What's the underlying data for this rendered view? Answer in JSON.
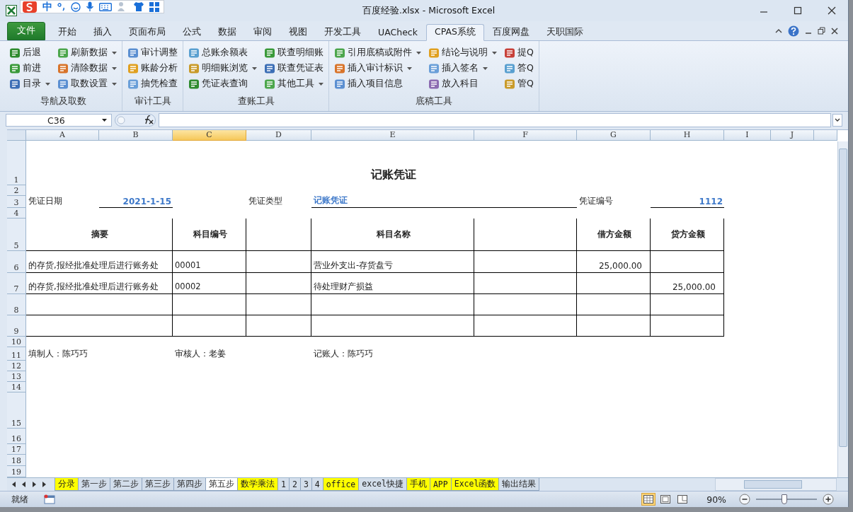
{
  "ime": {
    "label": "中"
  },
  "window": {
    "title": "百度经验.xlsx  -  Microsoft Excel"
  },
  "ribbon_tabs": [
    {
      "label": "文件",
      "kind": "file",
      "selected": false
    },
    {
      "label": "开始",
      "kind": "tab",
      "selected": false
    },
    {
      "label": "插入",
      "kind": "tab",
      "selected": false
    },
    {
      "label": "页面布局",
      "kind": "tab",
      "selected": false
    },
    {
      "label": "公式",
      "kind": "tab",
      "selected": false
    },
    {
      "label": "数据",
      "kind": "tab",
      "selected": false
    },
    {
      "label": "审阅",
      "kind": "tab",
      "selected": false
    },
    {
      "label": "视图",
      "kind": "tab",
      "selected": false
    },
    {
      "label": "开发工具",
      "kind": "tab",
      "selected": false
    },
    {
      "label": "UACheck",
      "kind": "tab",
      "selected": false
    },
    {
      "label": "CPAS系统",
      "kind": "tab",
      "selected": true
    },
    {
      "label": "百度网盘",
      "kind": "tab",
      "selected": false
    },
    {
      "label": "天职国际",
      "kind": "tab",
      "selected": false
    }
  ],
  "ribbon_groups": [
    {
      "label": "导航及取数",
      "columns": [
        [
          {
            "label": "后退",
            "dropdown": false
          },
          {
            "label": "前进",
            "dropdown": false
          },
          {
            "label": "目录",
            "dropdown": true
          }
        ],
        [
          {
            "label": "刷新数据",
            "dropdown": true
          },
          {
            "label": "清除数据",
            "dropdown": true
          },
          {
            "label": "取数设置",
            "dropdown": true
          }
        ]
      ]
    },
    {
      "label": "审计工具",
      "columns": [
        [
          {
            "label": "审计调整",
            "dropdown": false
          },
          {
            "label": "账龄分析",
            "dropdown": false
          },
          {
            "label": "抽凭检查",
            "dropdown": false
          }
        ]
      ]
    },
    {
      "label": "查账工具",
      "columns": [
        [
          {
            "label": "总账余额表",
            "dropdown": false
          },
          {
            "label": "明细账浏览",
            "dropdown": true
          },
          {
            "label": "凭证表查询",
            "dropdown": false
          }
        ],
        [
          {
            "label": "联查明细账",
            "dropdown": false
          },
          {
            "label": "联查凭证表",
            "dropdown": false
          },
          {
            "label": "其他工具",
            "dropdown": true
          }
        ]
      ]
    },
    {
      "label": "底稿工具",
      "columns": [
        [
          {
            "label": "引用底稿或附件",
            "dropdown": true
          },
          {
            "label": "插入审计标识",
            "dropdown": true
          },
          {
            "label": "插入项目信息",
            "dropdown": false
          }
        ],
        [
          {
            "label": "结论与说明",
            "dropdown": true
          },
          {
            "label": "插入签名",
            "dropdown": true
          },
          {
            "label": "放入科目",
            "dropdown": false
          }
        ],
        [
          {
            "label": "提Q",
            "dropdown": false
          },
          {
            "label": "答Q",
            "dropdown": false
          },
          {
            "label": "管Q",
            "dropdown": false
          }
        ]
      ]
    }
  ],
  "name_box": {
    "value": "C36"
  },
  "sheet": {
    "columns": [
      {
        "label": "A",
        "selected": false
      },
      {
        "label": "B",
        "selected": false
      },
      {
        "label": "C",
        "selected": true
      },
      {
        "label": "D",
        "selected": false
      },
      {
        "label": "E",
        "selected": false
      },
      {
        "label": "F",
        "selected": false
      },
      {
        "label": "G",
        "selected": false
      },
      {
        "label": "H",
        "selected": false
      },
      {
        "label": "I",
        "selected": false
      },
      {
        "label": "J",
        "selected": false
      }
    ],
    "rows": [
      "1",
      "2",
      "3",
      "4",
      "5",
      "6",
      "7",
      "8",
      "9",
      "10",
      "11",
      "12",
      "13",
      "14",
      "15",
      "16",
      "17",
      "18",
      "19"
    ],
    "cells": [
      {
        "kind": "title",
        "text": "记账凭证"
      },
      {
        "kind": "label",
        "text": "凭证日期"
      },
      {
        "kind": "figure",
        "text": "2021-1-15"
      },
      {
        "kind": "label",
        "text": "凭证类型"
      },
      {
        "kind": "field",
        "text": "记账凭证"
      },
      {
        "kind": "label",
        "text": "凭证编号"
      },
      {
        "kind": "figure",
        "text": "1112"
      },
      {
        "kind": "header",
        "text": "摘要"
      },
      {
        "kind": "header",
        "text": "科目编号"
      },
      {
        "kind": "header",
        "text": "科目名称"
      },
      {
        "kind": "header",
        "text": "借方金额"
      },
      {
        "kind": "header",
        "text": "贷方金额"
      },
      {
        "kind": "text",
        "text": "的存货,报经批准处理后进行账务处"
      },
      {
        "kind": "text",
        "text": "00001"
      },
      {
        "kind": "text",
        "text": "营业外支出-存货盘亏"
      },
      {
        "kind": "amount",
        "text": "25,000.00"
      },
      {
        "kind": "text",
        "text": "的存货,报经批准处理后进行账务处"
      },
      {
        "kind": "text",
        "text": "00002"
      },
      {
        "kind": "text",
        "text": "待处理财产损益"
      },
      {
        "kind": "amount",
        "text": "25,000.00"
      },
      {
        "kind": "label",
        "text": "填制人：陈巧巧"
      },
      {
        "kind": "label",
        "text": "审核人：老姜"
      },
      {
        "kind": "label",
        "text": "记账人：陈巧巧"
      }
    ]
  },
  "sheet_tabs": [
    {
      "label": "分录",
      "selected": false,
      "color": "#ffff00"
    },
    {
      "label": "第一步",
      "selected": false
    },
    {
      "label": "第二步",
      "selected": false
    },
    {
      "label": "第三步",
      "selected": false
    },
    {
      "label": "第四步",
      "selected": false
    },
    {
      "label": "第五步",
      "selected": true
    },
    {
      "label": "数学乘法",
      "selected": false,
      "color": "#ffff00"
    },
    {
      "label": "1",
      "selected": false
    },
    {
      "label": "2",
      "selected": false
    },
    {
      "label": "3",
      "selected": false
    },
    {
      "label": "4",
      "selected": false
    },
    {
      "label": "office",
      "selected": false,
      "color": "#ffff00"
    },
    {
      "label": "excel快捷",
      "selected": false
    },
    {
      "label": "手机",
      "selected": false,
      "color": "#ffff00"
    },
    {
      "label": "APP",
      "selected": false,
      "color": "#ffff00"
    },
    {
      "label": "Excel函数",
      "selected": false,
      "color": "#ffff00"
    },
    {
      "label": "输出结果",
      "selected": false
    }
  ],
  "status_bar": {
    "text": "就绪",
    "views": [
      {
        "selected": true
      },
      {
        "selected": false
      },
      {
        "selected": false
      }
    ],
    "zoom": "90%",
    "zoom_level": {
      "level": 0.47
    }
  }
}
